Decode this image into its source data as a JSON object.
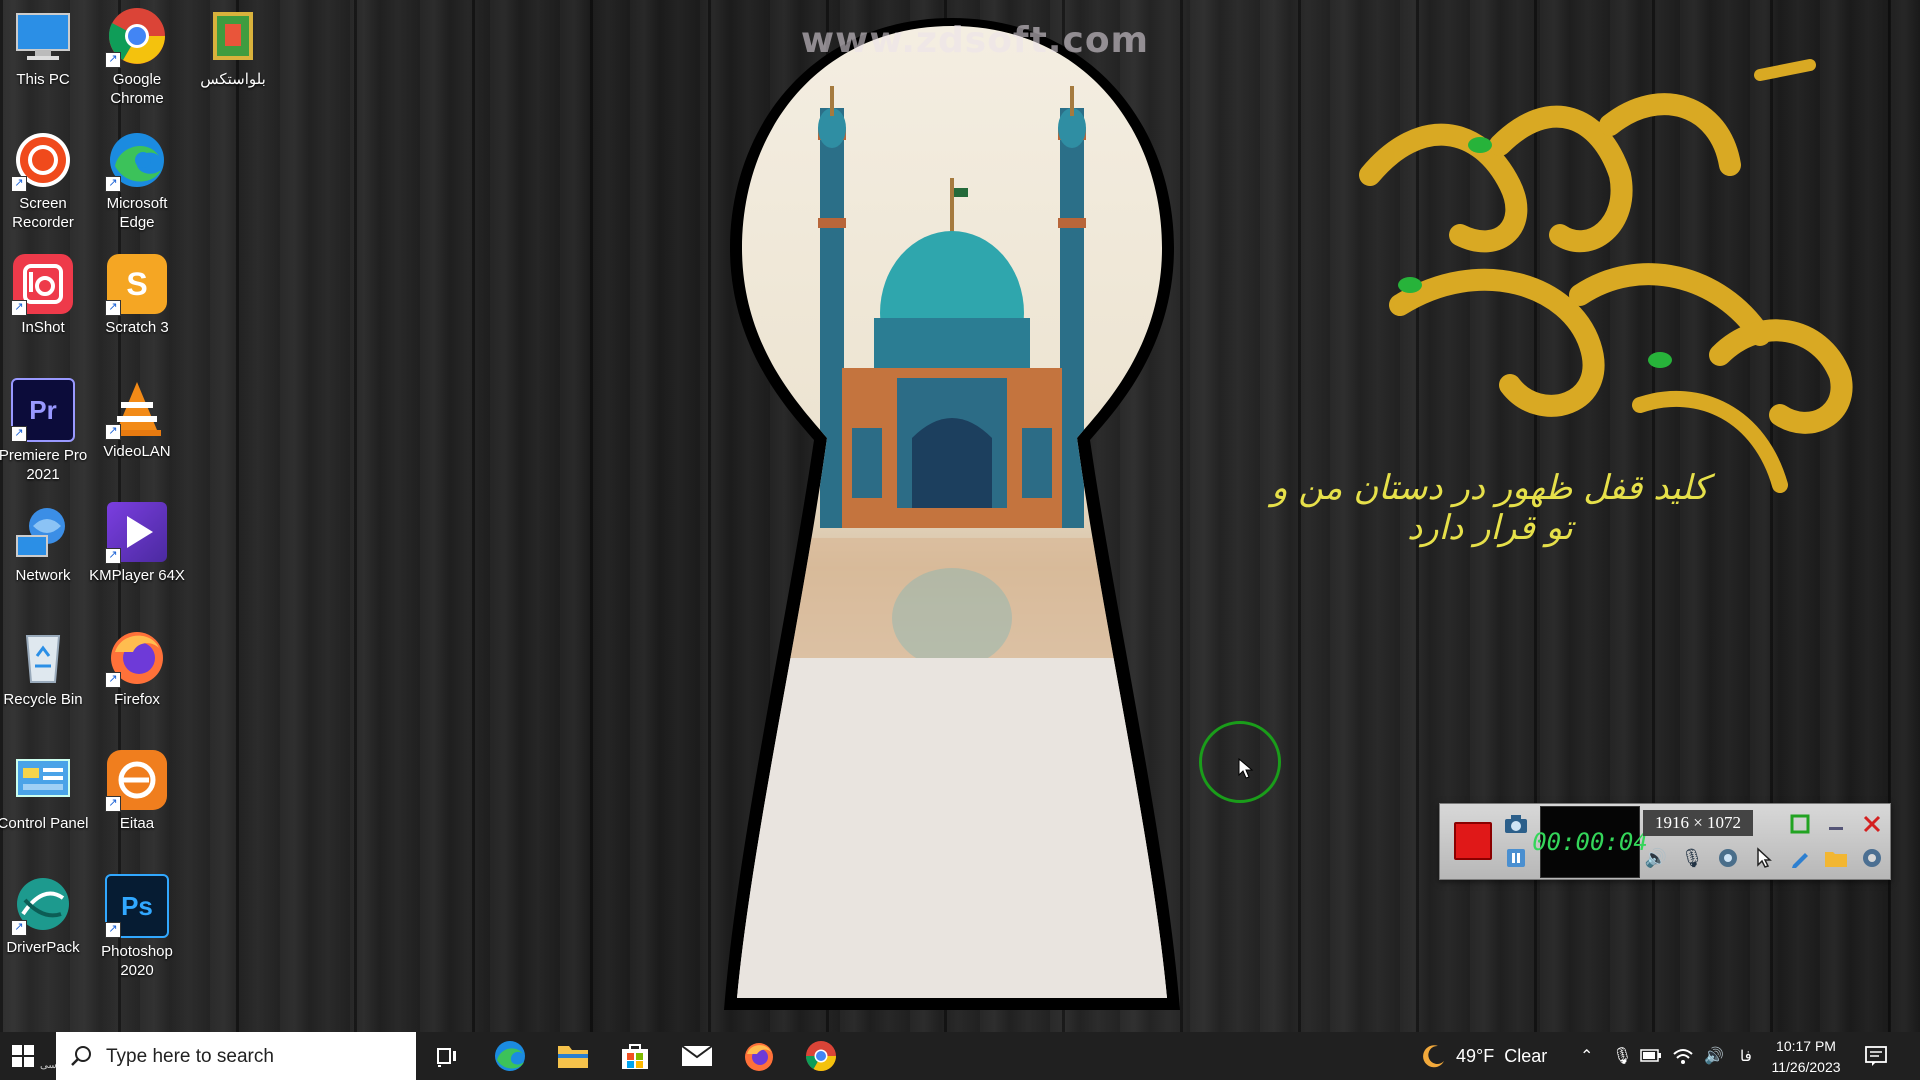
{
  "desktop": {
    "watermark": "www.zdsoft.com",
    "wallpaper_text": "کلید قفل ظهور در دستان من و تو قرار دارد",
    "icons": [
      {
        "label": "This PC",
        "icon": "this-pc-icon",
        "shortcut": false
      },
      {
        "label": "Google Chrome",
        "icon": "chrome-icon",
        "shortcut": true
      },
      {
        "label": "بلواستکس",
        "icon": "bluestacks-icon",
        "shortcut": false
      },
      {
        "label": "Screen Recorder",
        "icon": "screen-recorder-icon",
        "shortcut": true
      },
      {
        "label": "Microsoft Edge",
        "icon": "edge-icon",
        "shortcut": true
      },
      {
        "label": "InShot",
        "icon": "inshot-icon",
        "shortcut": true
      },
      {
        "label": "Scratch 3",
        "icon": "scratch-icon",
        "shortcut": true
      },
      {
        "label": "Premiere Pro 2021",
        "icon": "premiere-icon",
        "shortcut": true
      },
      {
        "label": "VideoLAN",
        "icon": "vlc-icon",
        "shortcut": true
      },
      {
        "label": "Network",
        "icon": "network-icon",
        "shortcut": false
      },
      {
        "label": "KMPlayer 64X",
        "icon": "kmplayer-icon",
        "shortcut": true
      },
      {
        "label": "Recycle Bin",
        "icon": "recycle-bin-icon",
        "shortcut": false
      },
      {
        "label": "Firefox",
        "icon": "firefox-icon",
        "shortcut": true
      },
      {
        "label": "Control Panel",
        "icon": "control-panel-icon",
        "shortcut": false
      },
      {
        "label": "Eitaa",
        "icon": "eitaa-icon",
        "shortcut": true
      },
      {
        "label": "DriverPack",
        "icon": "driverpack-icon",
        "shortcut": true
      },
      {
        "label": "Photoshop 2020",
        "icon": "photoshop-icon",
        "shortcut": true
      }
    ]
  },
  "recorder": {
    "timer": "00:00:04",
    "resolution": "1916 × 1072",
    "buttons": [
      "stop",
      "snapshot",
      "pause",
      "speaker",
      "microphone",
      "webcam",
      "cursor",
      "pen",
      "folder",
      "settings",
      "fullscreen",
      "minimize",
      "close"
    ]
  },
  "taskbar": {
    "start_badge": "فارسی",
    "search_placeholder": "Type here to search",
    "apps": [
      "task-view",
      "edge",
      "file-explorer",
      "store",
      "mail",
      "firefox",
      "chrome"
    ],
    "weather_temp": "49°F",
    "weather_text": "Clear",
    "language": "فا",
    "time": "10:17 PM",
    "date": "11/26/2023"
  },
  "colors": {
    "taskbar": "#202020",
    "record_red": "#e01818",
    "timer_green": "#34d65a",
    "calligraphy_gold": "#d9a923",
    "cursor_ring": "#1a9d1a"
  }
}
